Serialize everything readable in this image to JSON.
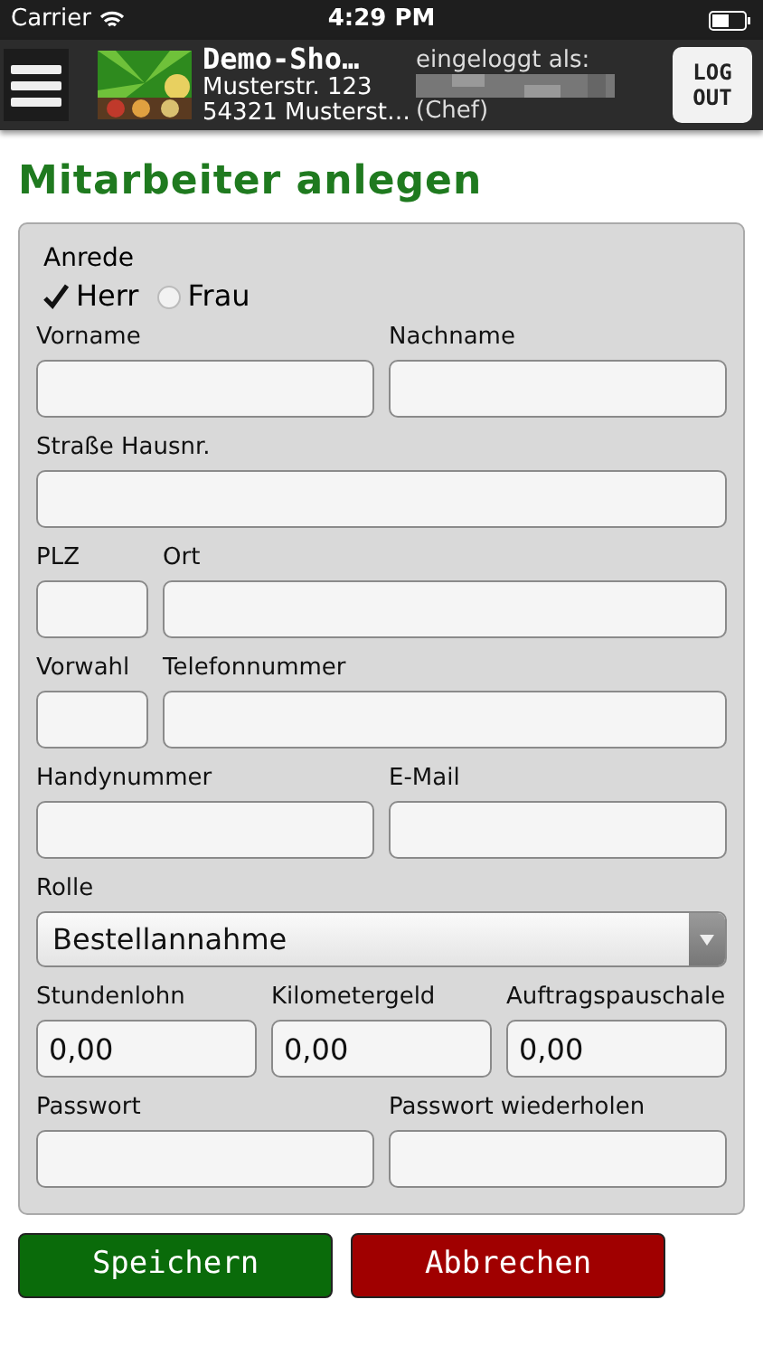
{
  "status_bar": {
    "carrier": "Carrier",
    "time": "4:29 PM"
  },
  "header": {
    "shop_name": "Demo-Sho…",
    "street": "Musterstr. 123",
    "city": "54321 Musterst…",
    "login_label": "eingeloggt als:",
    "role": "(Chef)",
    "logout": "LOG OUT"
  },
  "title": "Mitarbeiter anlegen",
  "salutation": {
    "label": "Anrede",
    "options": [
      {
        "label": "Herr",
        "selected": true
      },
      {
        "label": "Frau",
        "selected": false
      }
    ]
  },
  "rows": [
    [
      {
        "label": "Vorname",
        "kind": "text"
      },
      {
        "label": "Nachname",
        "kind": "text"
      }
    ],
    [
      {
        "label": "Straße Hausnr.",
        "kind": "text"
      }
    ],
    [
      {
        "label": "PLZ",
        "kind": "short"
      },
      {
        "label": "Ort",
        "kind": "text"
      }
    ],
    [
      {
        "label": "Vorwahl",
        "kind": "short"
      },
      {
        "label": "Telefonnummer",
        "kind": "text"
      }
    ],
    [
      {
        "label": "Handynummer",
        "kind": "text"
      },
      {
        "label": "E-Mail",
        "kind": "text"
      }
    ],
    [
      {
        "label": "Rolle",
        "kind": "select",
        "value": "Bestellannahme"
      }
    ],
    [
      {
        "label": "Stundenlohn",
        "kind": "text",
        "value": "0,00"
      },
      {
        "label": "Kilometergeld",
        "kind": "text",
        "value": "0,00"
      },
      {
        "label": "Auftragspauschale",
        "kind": "text",
        "value": "0,00"
      }
    ],
    [
      {
        "label": "Passwort",
        "kind": "text"
      },
      {
        "label": "Passwort wiederholen",
        "kind": "text"
      }
    ]
  ],
  "buttons": [
    {
      "label": "Speichern",
      "kind": "save"
    },
    {
      "label": "Abbrechen",
      "kind": "cancel"
    }
  ]
}
